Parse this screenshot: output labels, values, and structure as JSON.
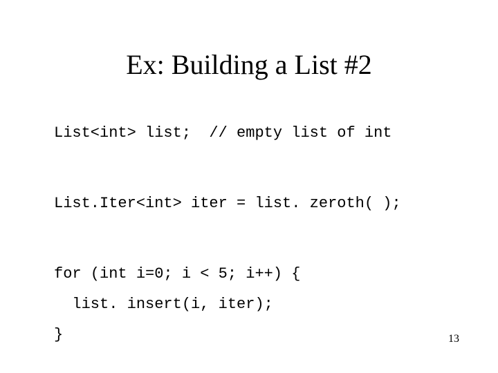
{
  "title": "Ex: Building a List #2",
  "code": {
    "l1": "List<int> list;  // empty list of int",
    "l2": "List.Iter<int> iter = list. zeroth( );",
    "l3": "for (int i=0; i < 5; i++) {",
    "l4": "  list. insert(i, iter);",
    "l5": "}"
  },
  "page_number": "13"
}
